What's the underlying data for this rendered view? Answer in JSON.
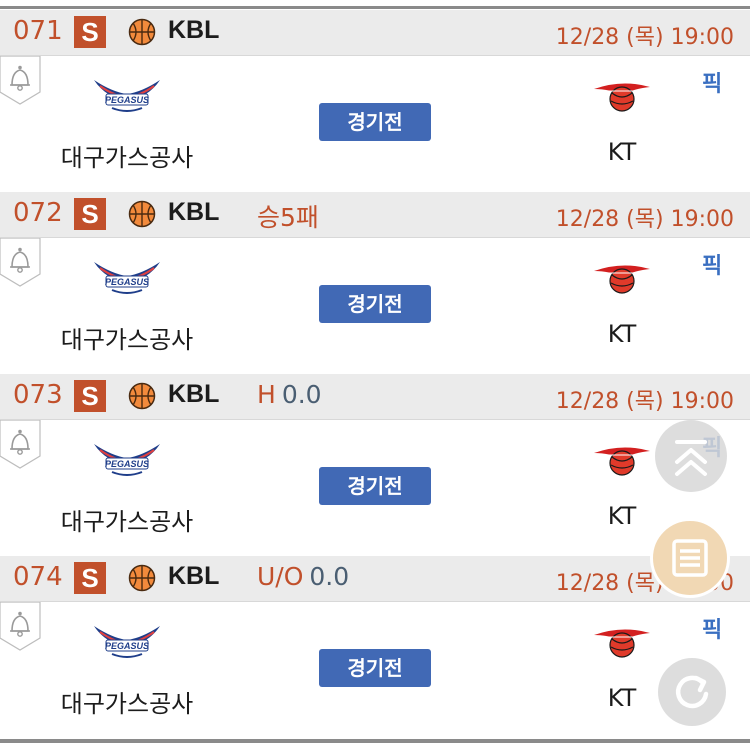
{
  "games": [
    {
      "number": "071",
      "badge": "S",
      "league": "KBL",
      "extra_label": "",
      "extra_value": "",
      "date": "12/28 (목)",
      "time": "19:00",
      "home": "대구가스공사",
      "status": "경기전",
      "away": "KT",
      "pick": "픽"
    },
    {
      "number": "072",
      "badge": "S",
      "league": "KBL",
      "extra_label": "승5패",
      "extra_value": "",
      "date": "12/28 (목)",
      "time": "19:00",
      "home": "대구가스공사",
      "status": "경기전",
      "away": "KT",
      "pick": "픽"
    },
    {
      "number": "073",
      "badge": "S",
      "league": "KBL",
      "extra_label": "H",
      "extra_value": "0.0",
      "date": "12/28 (목)",
      "time": "19:00",
      "home": "대구가스공사",
      "status": "경기전",
      "away": "KT",
      "pick": "픽"
    },
    {
      "number": "074",
      "badge": "S",
      "league": "KBL",
      "extra_label": "U/O",
      "extra_value": "0.0",
      "date": "12/28 (목)",
      "time": "19:00",
      "home": "대구가스공사",
      "status": "경기전",
      "away": "KT",
      "pick": "픽"
    }
  ],
  "home_logo_text": "PEGASUS",
  "colors": {
    "accent": "#c1502b",
    "status_button": "#4169b5",
    "pick": "#3a6fc1",
    "header_bg": "#ebebeb"
  },
  "icons": {
    "alarm": "bell-icon",
    "sport": "basketball-icon",
    "scroll_top": "scroll-top-icon",
    "list": "list-icon",
    "refresh": "refresh-icon"
  }
}
